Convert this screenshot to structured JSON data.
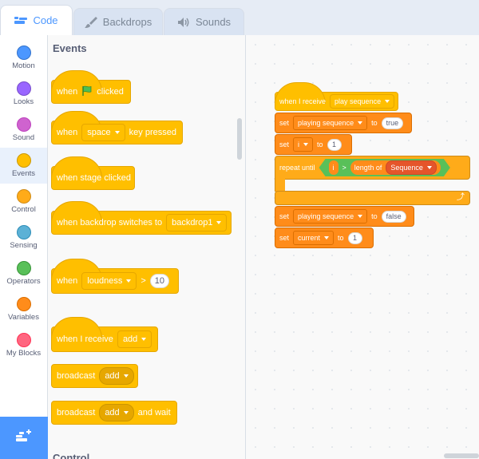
{
  "tabs": [
    {
      "label": "Code",
      "icon": "code-icon",
      "active": true
    },
    {
      "label": "Backdrops",
      "icon": "brush-icon",
      "active": false
    },
    {
      "label": "Sounds",
      "icon": "speaker-icon",
      "active": false
    }
  ],
  "categories": [
    {
      "label": "Motion",
      "color": "#4c97ff"
    },
    {
      "label": "Looks",
      "color": "#9966ff"
    },
    {
      "label": "Sound",
      "color": "#cf63cf"
    },
    {
      "label": "Events",
      "color": "#ffbf00",
      "active": true
    },
    {
      "label": "Control",
      "color": "#ffab19"
    },
    {
      "label": "Sensing",
      "color": "#5cb1d6"
    },
    {
      "label": "Operators",
      "color": "#59c059"
    },
    {
      "label": "Variables",
      "color": "#ff8c1a"
    },
    {
      "label": "My Blocks",
      "color": "#ff6680"
    }
  ],
  "palette": {
    "section_title": "Events",
    "next_section_title": "Control",
    "blocks": {
      "flag_when": "when",
      "flag_clicked": "clicked",
      "key_when": "when",
      "key_value": "space",
      "key_pressed": "key pressed",
      "stage_clicked": "when stage clicked",
      "backdrop_switches": "when backdrop switches to",
      "backdrop_value": "backdrop1",
      "loudness_when": "when",
      "loudness_value": "loudness",
      "loudness_op": ">",
      "loudness_num": "10",
      "receive_label": "when I receive",
      "receive_value": "add",
      "broadcast_label": "broadcast",
      "broadcast_value": "add",
      "broadcast_wait_label": "broadcast",
      "broadcast_wait_value": "add",
      "broadcast_wait_suffix": "and wait"
    }
  },
  "script": {
    "hat_label": "when I receive",
    "hat_value": "play sequence",
    "set1": {
      "label": "set",
      "var": "playing sequence",
      "to": "to",
      "value": "true"
    },
    "set2": {
      "label": "set",
      "var": "i",
      "to": "to",
      "value": "1"
    },
    "repeat": {
      "label": "repeat until",
      "var": "i",
      "op": ">",
      "length_label": "length of",
      "list": "Sequence"
    },
    "set3": {
      "label": "set",
      "var": "playing sequence",
      "to": "to",
      "value": "false"
    },
    "set4": {
      "label": "set",
      "var": "current",
      "to": "to",
      "value": "1"
    }
  }
}
